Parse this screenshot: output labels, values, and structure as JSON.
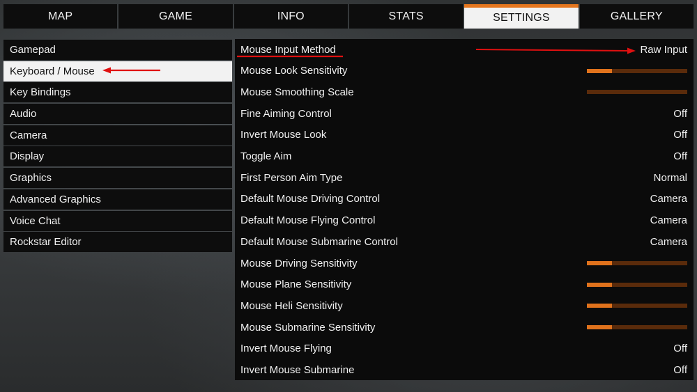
{
  "tabs": [
    "MAP",
    "GAME",
    "INFO",
    "STATS",
    "SETTINGS",
    "GALLERY"
  ],
  "active_tab": "SETTINGS",
  "sidebar": {
    "items": [
      {
        "label": "Gamepad"
      },
      {
        "label": "Keyboard / Mouse",
        "active": true
      },
      {
        "label": "Key Bindings"
      },
      {
        "label": "Audio"
      },
      {
        "label": "Camera"
      },
      {
        "label": "Display"
      },
      {
        "label": "Graphics"
      },
      {
        "label": "Advanced Graphics"
      },
      {
        "label": "Voice Chat"
      },
      {
        "label": "Rockstar Editor"
      }
    ]
  },
  "settings": [
    {
      "label": "Mouse Input Method",
      "type": "value",
      "value": "Raw Input"
    },
    {
      "label": "Mouse Look Sensitivity",
      "type": "slider",
      "level": 0.25
    },
    {
      "label": "Mouse Smoothing Scale",
      "type": "slider",
      "level": 0
    },
    {
      "label": "Fine Aiming Control",
      "type": "value",
      "value": "Off"
    },
    {
      "label": "Invert Mouse Look",
      "type": "value",
      "value": "Off"
    },
    {
      "label": "Toggle Aim",
      "type": "value",
      "value": "Off"
    },
    {
      "label": "First Person Aim Type",
      "type": "value",
      "value": "Normal"
    },
    {
      "label": "Default Mouse Driving Control",
      "type": "value",
      "value": "Camera"
    },
    {
      "label": "Default Mouse Flying Control",
      "type": "value",
      "value": "Camera"
    },
    {
      "label": "Default Mouse Submarine Control",
      "type": "value",
      "value": "Camera"
    },
    {
      "label": "Mouse Driving Sensitivity",
      "type": "slider",
      "level": 0.25
    },
    {
      "label": "Mouse Plane Sensitivity",
      "type": "slider",
      "level": 0.25
    },
    {
      "label": "Mouse Heli Sensitivity",
      "type": "slider",
      "level": 0.25
    },
    {
      "label": "Mouse Submarine Sensitivity",
      "type": "slider",
      "level": 0.25
    },
    {
      "label": "Invert Mouse Flying",
      "type": "value",
      "value": "Off"
    },
    {
      "label": "Invert Mouse Submarine",
      "type": "value",
      "value": "Off"
    }
  ],
  "colors": {
    "accent": "#e5761e",
    "slider_fill": "#e0721c",
    "slider_track": "#5a2b0b",
    "annotation": "#e01010"
  }
}
